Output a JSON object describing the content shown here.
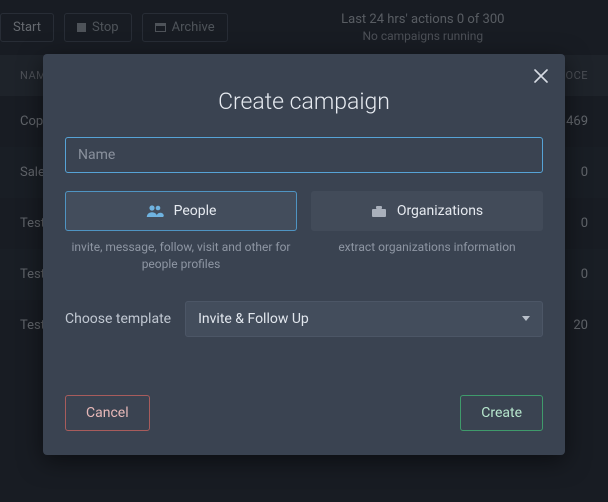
{
  "toolbar": {
    "start": "Start",
    "stop": "Stop",
    "archive": "Archive",
    "status_line1": "Last 24 hrs' actions 0 of 300",
    "status_line2": "No campaigns running"
  },
  "table": {
    "header_name": "NAME",
    "header_proc": "PROCE",
    "rows": [
      {
        "name": "Copy",
        "val": "469"
      },
      {
        "name": "Sales",
        "val": "0"
      },
      {
        "name": "Test",
        "val": "0"
      },
      {
        "name": "Test",
        "val": "0"
      },
      {
        "name": "Test",
        "val": "20"
      }
    ]
  },
  "modal": {
    "title": "Create campaign",
    "name_placeholder": "Name",
    "people_label": "People",
    "org_label": "Organizations",
    "people_desc": "invite, message, follow, visit and other for people profiles",
    "org_desc": "extract organizations information",
    "template_label": "Choose template",
    "template_selected": "Invite & Follow Up",
    "cancel": "Cancel",
    "create": "Create"
  }
}
